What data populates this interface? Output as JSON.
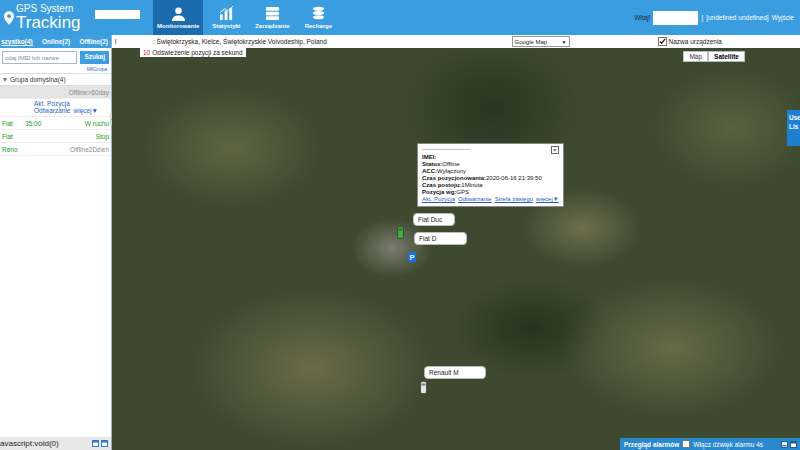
{
  "header": {
    "logo": [
      "GPS System",
      "Tracking"
    ],
    "nav": [
      {
        "label": "Monitorowanie",
        "selected": true
      },
      {
        "label": "Statystyki",
        "selected": false
      },
      {
        "label": "Zarządzanie",
        "selected": false
      },
      {
        "label": "Recharge",
        "selected": false
      }
    ],
    "greeting": "Witaj!",
    "separator": "|",
    "user": "[undefined undefined]",
    "logout": "Wyjście"
  },
  "sidebar": {
    "tabs": [
      {
        "label": "szystko(4)",
        "selected": true
      },
      {
        "label": "Online(2)",
        "selected": false
      },
      {
        "label": "Offline(2)",
        "selected": false
      }
    ],
    "search": {
      "placeholder": "odaj IMEI lub nazwe",
      "button": "Szukaj"
    },
    "group_link": "MilGrupa",
    "group": {
      "label": "Grupa domyślna(4)",
      "expanded": true
    },
    "rows": [
      {
        "name": "",
        "time": "",
        "status": "Offline>60day",
        "color": "#8a8a8a",
        "expanded": true
      },
      {
        "name": "Fiat",
        "time": "35:00",
        "status": "W ruchu",
        "color": "#18a018",
        "expanded": false
      },
      {
        "name": "Fiat",
        "time": "",
        "status": "Stop",
        "color": "#18a018",
        "expanded": false
      },
      {
        "name": "Reno",
        "time": "",
        "status": "Offline2Dzien",
        "color": "#8a8a8a",
        "expanded": false
      }
    ],
    "actions": [
      "Akt. Pozycja",
      "Odtwarzanie",
      "więcej▼"
    ],
    "collapse": "◀"
  },
  "toolbar": {
    "marker": "l",
    "address": ": Świętokrzyska, Kielce, Świętokrzyskie Voivodeship, Poland",
    "map_select": {
      "value": "Google Map",
      "arrow": "▼"
    },
    "device_names": {
      "label": "Nazwa urządzenia",
      "checked": true
    }
  },
  "map": {
    "refresh": {
      "count": "10",
      "label": "Odświeżenie pozycji za sekund"
    },
    "map_types": [
      {
        "label": "Map",
        "selected": false
      },
      {
        "label": "Satellite",
        "selected": true
      }
    ],
    "side_tab": [
      "Use",
      "Lis"
    ],
    "popup": {
      "title": "------------------------",
      "close": "×",
      "lines": [
        {
          "label": "IMEI:",
          "value": ""
        },
        {
          "label": "Status:",
          "value": "Offline"
        },
        {
          "label": "ACC:",
          "value": "Wyłączony"
        },
        {
          "label": "Czas pozycjonowania:",
          "value": "2020-06-16 21:39:50"
        },
        {
          "label": "Czas postoju:",
          "value": "1Minuta"
        },
        {
          "label": "Pozycja wg:",
          "value": "GPS"
        }
      ],
      "links": [
        "Akt. Pozycja",
        "Odtwarzanie",
        "Strefa zasięgu",
        "więcej▼"
      ]
    },
    "vehicles": [
      {
        "label": "Fiat Duc",
        "kind": "car",
        "badge": "",
        "color": "#3cae3c"
      },
      {
        "label": "Fiat D",
        "kind": "parking",
        "badge": "P",
        "color": "#1e6fd9"
      },
      {
        "label": "Renault M",
        "kind": "car",
        "badge": "",
        "color": "#e6e6e6"
      }
    ]
  },
  "alarm_bar": {
    "title": "Przegląd alarmów",
    "sound": {
      "label": "Włącz dźwięk alarmu 4s",
      "checked": false
    }
  },
  "status_bar": "avascript:void(0)"
}
